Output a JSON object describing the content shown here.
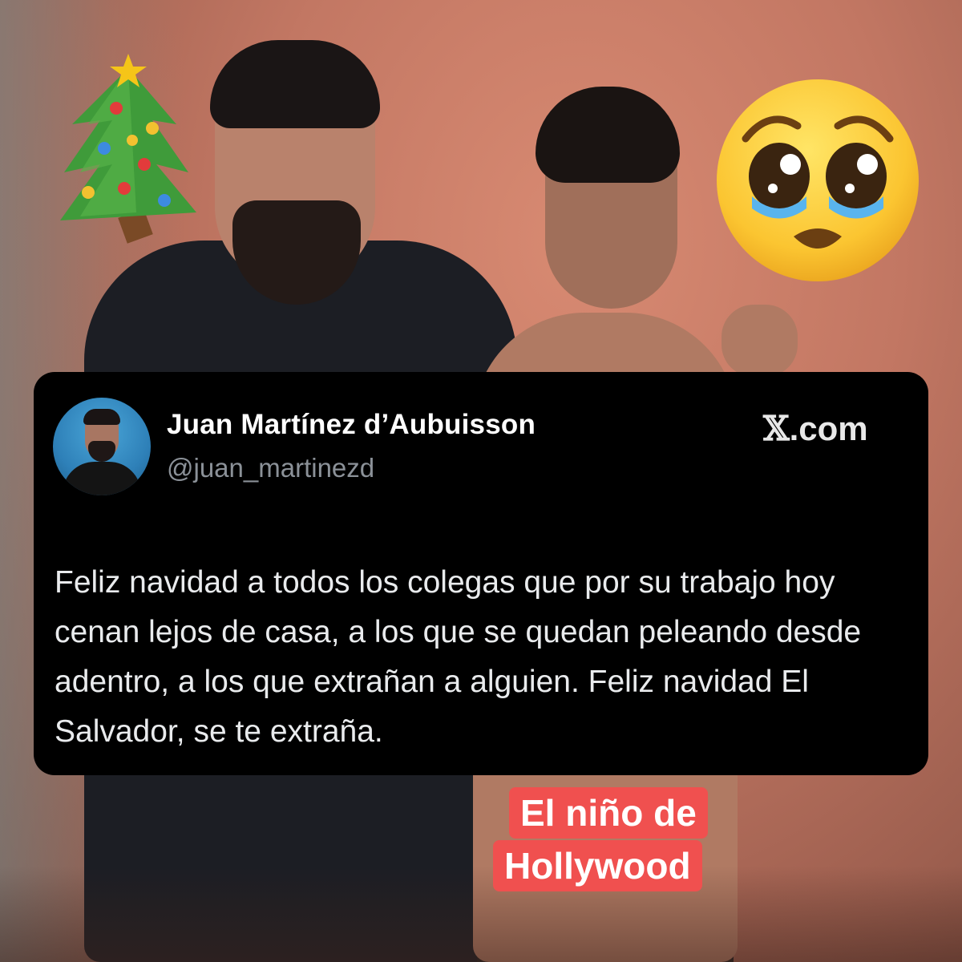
{
  "post": {
    "author_name": "Juan Martínez d’Aubuisson",
    "author_handle": "@juan_martinezd",
    "source": "X.com",
    "source_x": "𝕏",
    "source_rest": ".com",
    "text": "Feliz navidad a todos los colegas que por su trabajo hoy cenan lejos de casa, a los que se quedan peleando desde adentro, a los que extrañan a alguien. Feliz navidad El Salvador, se te extraña."
  },
  "caption": {
    "line1": "El niño de",
    "line2": "Hollywood"
  },
  "stickers": {
    "top_left": "christmas-tree-emoji",
    "top_right": "pleading-face-emoji"
  },
  "colors": {
    "card_background": "#000000",
    "caption_background": "#f0504f",
    "handle_gray": "#8b9198"
  }
}
